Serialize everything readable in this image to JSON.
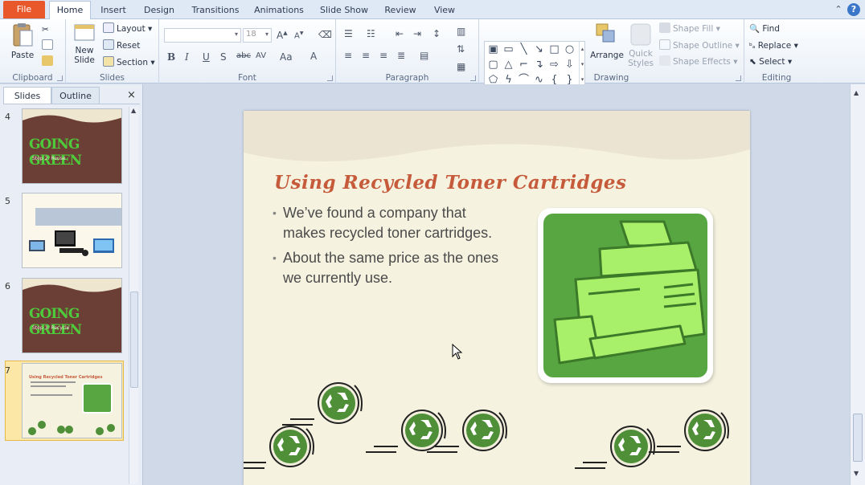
{
  "tabs": [
    {
      "label": "File"
    },
    {
      "label": "Home"
    },
    {
      "label": "Insert"
    },
    {
      "label": "Design"
    },
    {
      "label": "Transitions"
    },
    {
      "label": "Animations"
    },
    {
      "label": "Slide Show"
    },
    {
      "label": "Review"
    },
    {
      "label": "View"
    }
  ],
  "ribbon": {
    "clipboard": {
      "label": "Clipboard",
      "paste": "Paste"
    },
    "slides": {
      "label": "Slides",
      "new_slide_1": "New",
      "new_slide_2": "Slide",
      "layout": "Layout",
      "reset": "Reset",
      "section": "Section"
    },
    "font": {
      "label": "Font",
      "size": "18",
      "shadow_s": "S",
      "case": "Aa",
      "spacing": "AV"
    },
    "paragraph": {
      "label": "Paragraph"
    },
    "drawing": {
      "label": "Drawing",
      "arrange": "Arrange",
      "quick_styles_1": "Quick",
      "quick_styles_2": "Styles",
      "shape_fill": "Shape Fill",
      "shape_outline": "Shape Outline",
      "shape_effects": "Shape Effects"
    },
    "editing": {
      "label": "Editing",
      "find": "Find",
      "replace": "Replace",
      "select": "Select"
    }
  },
  "pane": {
    "tab_slides": "Slides",
    "tab_outline": "Outline",
    "close": "×",
    "thumbnails": [
      {
        "number": "4",
        "title": "GOING GREEN",
        "subtitle": "Step 2: Reuse"
      },
      {
        "number": "5"
      },
      {
        "number": "6",
        "title": "GOING GREEN",
        "subtitle": "Step 3: Recycle"
      },
      {
        "number": "7",
        "title": "Using Recycled Toner Cartridges"
      }
    ]
  },
  "slide": {
    "title": "Using Recycled Toner Cartridges",
    "bullets": [
      "We’ve found a company that makes recycled toner cartridges.",
      "About the same price as the ones we currently use."
    ]
  },
  "colors": {
    "file_tab": "#e8582a",
    "title_text": "#c65b3c",
    "printer_bg": "#57a642",
    "printer_fg": "#a8f06a",
    "thumb_brown": "#6b3f36",
    "going_green": "#4ecb3a"
  },
  "icons": [
    "paste-icon",
    "cut-icon",
    "copy-icon",
    "format-painter-icon",
    "new-slide-icon",
    "find-icon",
    "replace-icon",
    "select-icon",
    "printer-icon",
    "recycle-icon",
    "cursor-icon",
    "close-icon"
  ]
}
